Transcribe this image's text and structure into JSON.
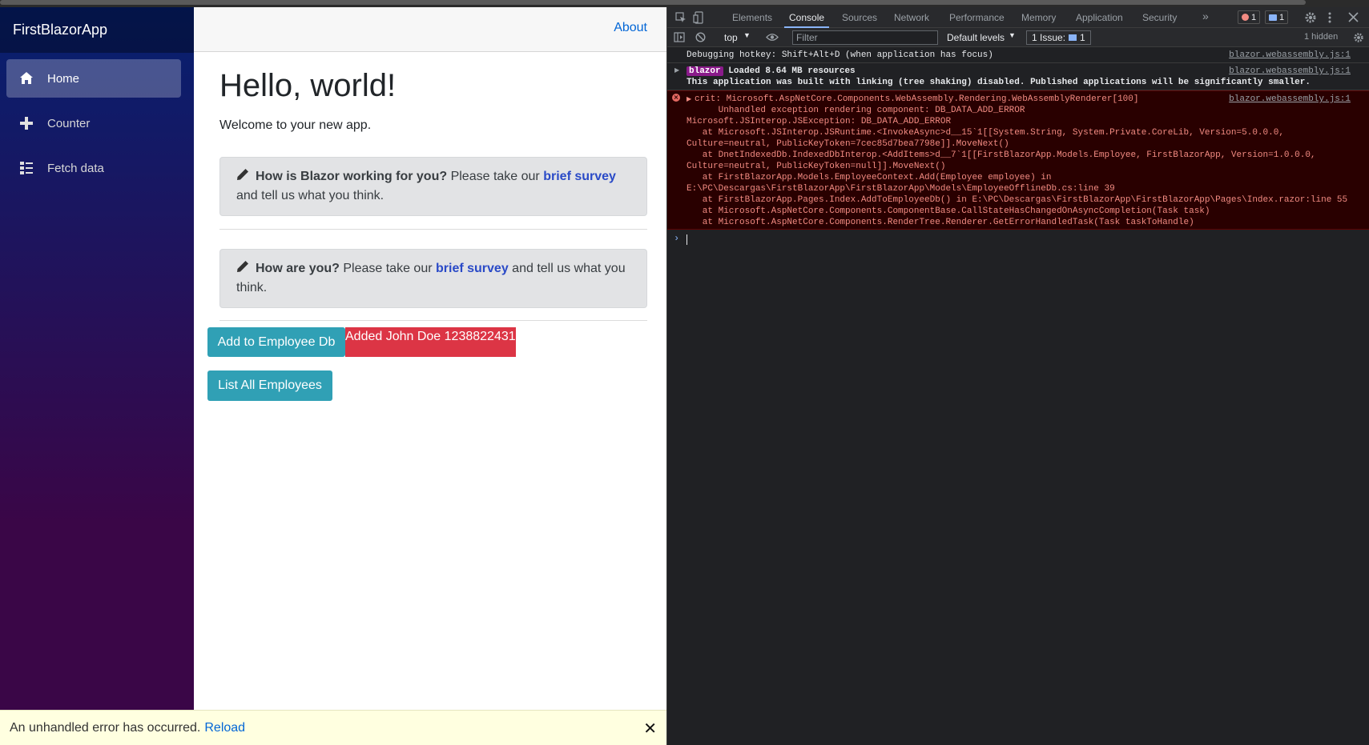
{
  "app": {
    "brand": "FirstBlazorApp",
    "nav": [
      {
        "label": "Home",
        "icon": "home-icon"
      },
      {
        "label": "Counter",
        "icon": "plus-icon"
      },
      {
        "label": "Fetch data",
        "icon": "list-icon"
      }
    ],
    "about_link": "About",
    "title": "Hello, world!",
    "welcome": "Welcome to your new app.",
    "survey1": {
      "bold": "How is Blazor working for you?",
      "pre": "Please take our",
      "link": "brief survey",
      "post": "and tell us what you think."
    },
    "survey2": {
      "bold": "How are you?",
      "pre": "Please take our",
      "link": "brief survey",
      "post": "and tell us what you think."
    },
    "add_button": "Add to Employee Db",
    "added_message": "Added John Doe 1238822431",
    "list_button": "List All Employees",
    "error_ui": {
      "message": "An unhandled error has occurred.",
      "reload": "Reload",
      "close": "✕"
    }
  },
  "devtools": {
    "tabs": [
      "Elements",
      "Console",
      "Sources",
      "Network",
      "Performance",
      "Memory",
      "Application",
      "Security"
    ],
    "active_tab": "Console",
    "more": "»",
    "error_count": "1",
    "message_count": "1",
    "context": "top",
    "filter_placeholder": "Filter",
    "levels": "Default levels",
    "issues_label": "1 Issue:",
    "issues_count": "1",
    "hidden": "1 hidden",
    "console": {
      "hotkey": "Debugging hotkey: Shift+Alt+D (when application has focus)",
      "source": "blazor.webassembly.js:1",
      "blazor_tag": "blazor",
      "loaded": "Loaded 8.64 MB resources",
      "linking": "This application was built with linking (tree shaking) disabled. Published applications will be significantly smaller.",
      "error_lines": [
        "crit: Microsoft.AspNetCore.Components.WebAssembly.Rendering.WebAssemblyRenderer[100]",
        "      Unhandled exception rendering component: DB_DATA_ADD_ERROR",
        "Microsoft.JSInterop.JSException: DB_DATA_ADD_ERROR",
        "   at Microsoft.JSInterop.JSRuntime.<InvokeAsync>d__15`1[[System.String, System.Private.CoreLib, Version=5.0.0.0,",
        "Culture=neutral, PublicKeyToken=7cec85d7bea7798e]].MoveNext()",
        "   at DnetIndexedDb.IndexedDbInterop.<AddItems>d__7`1[[FirstBlazorApp.Models.Employee, FirstBlazorApp, Version=1.0.0.0,",
        "Culture=neutral, PublicKeyToken=null]].MoveNext()",
        "   at FirstBlazorApp.Models.EmployeeContext.Add(Employee employee) in",
        "E:\\PC\\Descargas\\FirstBlazorApp\\FirstBlazorApp\\Models\\EmployeeOfflineDb.cs:line 39",
        "   at FirstBlazorApp.Pages.Index.AddToEmployeeDb() in E:\\PC\\Descargas\\FirstBlazorApp\\FirstBlazorApp\\Pages\\Index.razor:line 55",
        "   at Microsoft.AspNetCore.Components.ComponentBase.CallStateHasChangedOnAsyncCompletion(Task task)",
        "   at Microsoft.AspNetCore.Components.RenderTree.Renderer.GetErrorHandledTask(Task taskToHandle)"
      ],
      "prompt": "›"
    }
  }
}
